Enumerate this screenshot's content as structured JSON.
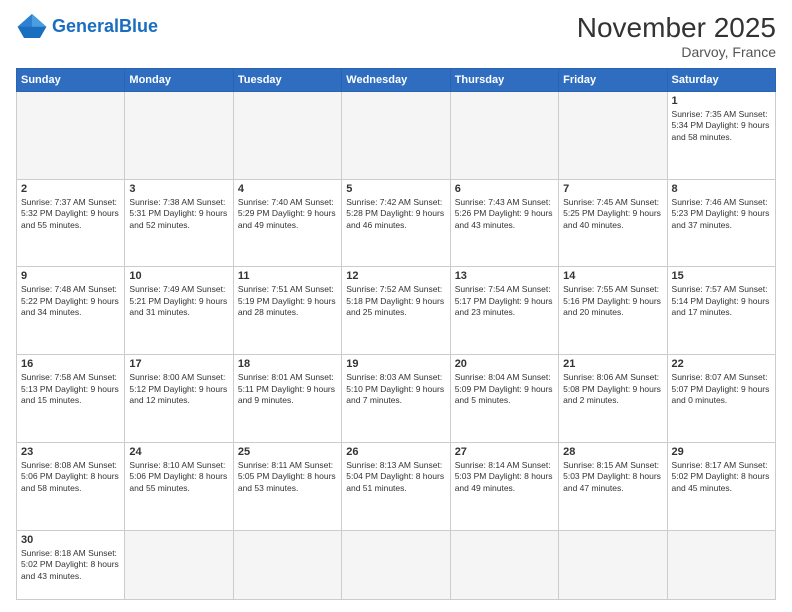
{
  "header": {
    "logo_general": "General",
    "logo_blue": "Blue",
    "month_year": "November 2025",
    "location": "Darvoy, France"
  },
  "weekdays": [
    "Sunday",
    "Monday",
    "Tuesday",
    "Wednesday",
    "Thursday",
    "Friday",
    "Saturday"
  ],
  "weeks": [
    [
      {
        "day": "",
        "info": ""
      },
      {
        "day": "",
        "info": ""
      },
      {
        "day": "",
        "info": ""
      },
      {
        "day": "",
        "info": ""
      },
      {
        "day": "",
        "info": ""
      },
      {
        "day": "",
        "info": ""
      },
      {
        "day": "1",
        "info": "Sunrise: 7:35 AM\nSunset: 5:34 PM\nDaylight: 9 hours\nand 58 minutes."
      }
    ],
    [
      {
        "day": "2",
        "info": "Sunrise: 7:37 AM\nSunset: 5:32 PM\nDaylight: 9 hours\nand 55 minutes."
      },
      {
        "day": "3",
        "info": "Sunrise: 7:38 AM\nSunset: 5:31 PM\nDaylight: 9 hours\nand 52 minutes."
      },
      {
        "day": "4",
        "info": "Sunrise: 7:40 AM\nSunset: 5:29 PM\nDaylight: 9 hours\nand 49 minutes."
      },
      {
        "day": "5",
        "info": "Sunrise: 7:42 AM\nSunset: 5:28 PM\nDaylight: 9 hours\nand 46 minutes."
      },
      {
        "day": "6",
        "info": "Sunrise: 7:43 AM\nSunset: 5:26 PM\nDaylight: 9 hours\nand 43 minutes."
      },
      {
        "day": "7",
        "info": "Sunrise: 7:45 AM\nSunset: 5:25 PM\nDaylight: 9 hours\nand 40 minutes."
      },
      {
        "day": "8",
        "info": "Sunrise: 7:46 AM\nSunset: 5:23 PM\nDaylight: 9 hours\nand 37 minutes."
      }
    ],
    [
      {
        "day": "9",
        "info": "Sunrise: 7:48 AM\nSunset: 5:22 PM\nDaylight: 9 hours\nand 34 minutes."
      },
      {
        "day": "10",
        "info": "Sunrise: 7:49 AM\nSunset: 5:21 PM\nDaylight: 9 hours\nand 31 minutes."
      },
      {
        "day": "11",
        "info": "Sunrise: 7:51 AM\nSunset: 5:19 PM\nDaylight: 9 hours\nand 28 minutes."
      },
      {
        "day": "12",
        "info": "Sunrise: 7:52 AM\nSunset: 5:18 PM\nDaylight: 9 hours\nand 25 minutes."
      },
      {
        "day": "13",
        "info": "Sunrise: 7:54 AM\nSunset: 5:17 PM\nDaylight: 9 hours\nand 23 minutes."
      },
      {
        "day": "14",
        "info": "Sunrise: 7:55 AM\nSunset: 5:16 PM\nDaylight: 9 hours\nand 20 minutes."
      },
      {
        "day": "15",
        "info": "Sunrise: 7:57 AM\nSunset: 5:14 PM\nDaylight: 9 hours\nand 17 minutes."
      }
    ],
    [
      {
        "day": "16",
        "info": "Sunrise: 7:58 AM\nSunset: 5:13 PM\nDaylight: 9 hours\nand 15 minutes."
      },
      {
        "day": "17",
        "info": "Sunrise: 8:00 AM\nSunset: 5:12 PM\nDaylight: 9 hours\nand 12 minutes."
      },
      {
        "day": "18",
        "info": "Sunrise: 8:01 AM\nSunset: 5:11 PM\nDaylight: 9 hours\nand 9 minutes."
      },
      {
        "day": "19",
        "info": "Sunrise: 8:03 AM\nSunset: 5:10 PM\nDaylight: 9 hours\nand 7 minutes."
      },
      {
        "day": "20",
        "info": "Sunrise: 8:04 AM\nSunset: 5:09 PM\nDaylight: 9 hours\nand 5 minutes."
      },
      {
        "day": "21",
        "info": "Sunrise: 8:06 AM\nSunset: 5:08 PM\nDaylight: 9 hours\nand 2 minutes."
      },
      {
        "day": "22",
        "info": "Sunrise: 8:07 AM\nSunset: 5:07 PM\nDaylight: 9 hours\nand 0 minutes."
      }
    ],
    [
      {
        "day": "23",
        "info": "Sunrise: 8:08 AM\nSunset: 5:06 PM\nDaylight: 8 hours\nand 58 minutes."
      },
      {
        "day": "24",
        "info": "Sunrise: 8:10 AM\nSunset: 5:06 PM\nDaylight: 8 hours\nand 55 minutes."
      },
      {
        "day": "25",
        "info": "Sunrise: 8:11 AM\nSunset: 5:05 PM\nDaylight: 8 hours\nand 53 minutes."
      },
      {
        "day": "26",
        "info": "Sunrise: 8:13 AM\nSunset: 5:04 PM\nDaylight: 8 hours\nand 51 minutes."
      },
      {
        "day": "27",
        "info": "Sunrise: 8:14 AM\nSunset: 5:03 PM\nDaylight: 8 hours\nand 49 minutes."
      },
      {
        "day": "28",
        "info": "Sunrise: 8:15 AM\nSunset: 5:03 PM\nDaylight: 8 hours\nand 47 minutes."
      },
      {
        "day": "29",
        "info": "Sunrise: 8:17 AM\nSunset: 5:02 PM\nDaylight: 8 hours\nand 45 minutes."
      }
    ],
    [
      {
        "day": "30",
        "info": "Sunrise: 8:18 AM\nSunset: 5:02 PM\nDaylight: 8 hours\nand 43 minutes."
      },
      {
        "day": "",
        "info": ""
      },
      {
        "day": "",
        "info": ""
      },
      {
        "day": "",
        "info": ""
      },
      {
        "day": "",
        "info": ""
      },
      {
        "day": "",
        "info": ""
      },
      {
        "day": "",
        "info": ""
      }
    ]
  ]
}
